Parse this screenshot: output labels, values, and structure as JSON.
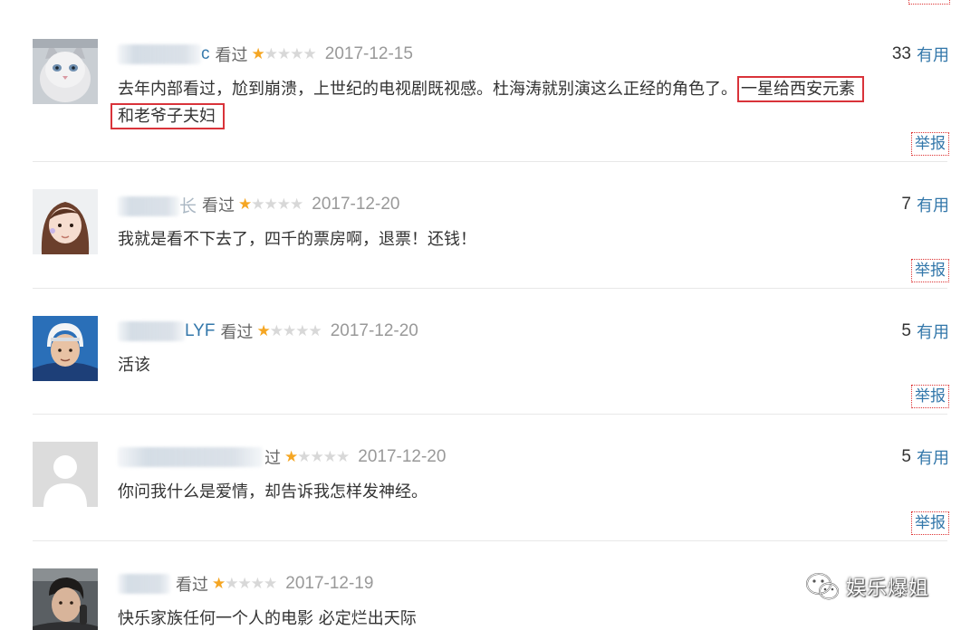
{
  "comments": [
    {
      "user_suffix": "c",
      "watched_label": "看过",
      "rating": 1,
      "date": "2017-12-15",
      "votes": "33",
      "useful_label": "有用",
      "text_plain": "去年内部看过，尬到崩溃，上世纪的电视剧既视感。杜海涛就别演这么正经的角色了。",
      "text_highlight_1": "一星给西安元素",
      "text_highlight_2": "和老爷子夫妇",
      "report_label": "举报"
    },
    {
      "user_visible": "长",
      "watched_label": "看过",
      "rating": 1,
      "date": "2017-12-20",
      "votes": "7",
      "useful_label": "有用",
      "text": "我就是看不下去了，四千的票房啊，退票！还钱！",
      "report_label": "举报"
    },
    {
      "user_suffix": "LYF",
      "watched_label": "看过",
      "rating": 1,
      "date": "2017-12-20",
      "votes": "5",
      "useful_label": "有用",
      "text": "活该",
      "report_label": "举报"
    },
    {
      "watched_label": "过",
      "rating": 1,
      "date": "2017-12-20",
      "votes": "5",
      "useful_label": "有用",
      "text": "你问我什么是爱情，却告诉我怎样发神经。",
      "report_label": "举报"
    },
    {
      "watched_label": "看过",
      "rating": 1,
      "date": "2017-12-19",
      "text": "快乐家族任何一个人的电影 必定烂出天际"
    }
  ],
  "watermark": {
    "text": "娱乐爆姐",
    "icon": "wechat-icon"
  },
  "colors": {
    "link": "#3377aa",
    "star": "#f5a623",
    "highlight_box": "#d9333a",
    "date": "#999999"
  }
}
